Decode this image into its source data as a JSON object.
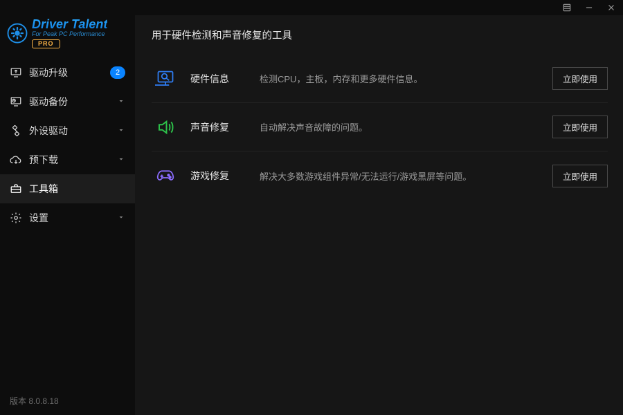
{
  "brand": {
    "title": "Driver Talent",
    "subtitle": "For Peak PC Performance",
    "badge": "PRO"
  },
  "sidebar": {
    "items": [
      {
        "label": "驱动升级",
        "badge": "2",
        "expandable": false
      },
      {
        "label": "驱动备份",
        "expandable": true
      },
      {
        "label": "外设驱动",
        "expandable": true
      },
      {
        "label": "预下载",
        "expandable": true
      },
      {
        "label": "工具箱",
        "expandable": false,
        "active": true
      },
      {
        "label": "设置",
        "expandable": true
      }
    ]
  },
  "version_prefix": "版本",
  "version_value": "8.0.8.18",
  "page": {
    "title": "用于硬件检测和声音修复的工具",
    "cta": "立即使用",
    "tools": [
      {
        "name": "硬件信息",
        "desc": "检测CPU，主板，内存和更多硬件信息。",
        "icon_color": "#2f7ef6"
      },
      {
        "name": "声音修复",
        "desc": "自动解决声音故障的问题。",
        "icon_color": "#2dc24a"
      },
      {
        "name": "游戏修复",
        "desc": "解决大多数游戏组件异常/无法运行/游戏黑屏等问题。",
        "icon_color": "#8b6cff"
      }
    ]
  }
}
